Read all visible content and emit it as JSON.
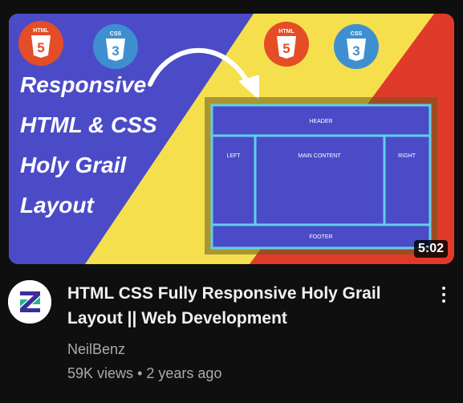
{
  "video": {
    "thumbnail": {
      "headline_lines": [
        "Responsive",
        "HTML & CSS",
        "Holy Grail",
        "Layout"
      ],
      "badges": [
        "HTML",
        "CSS",
        "HTML",
        "CSS"
      ],
      "layout_labels": {
        "header": "HEADER",
        "left": "LEFT",
        "main": "MAIN CONTENT",
        "right": "RIGHT",
        "footer": "FOOTER"
      },
      "colors": {
        "blue": "#4b4bc8",
        "yellow": "#f5df4d",
        "red": "#e03a2a",
        "html_badge": "#e44d26",
        "css_badge": "#3f8fd0"
      }
    },
    "duration": "5:02",
    "title": "HTML CSS Fully Responsive Holy Grail Layout || Web Development",
    "channel": "NeilBenz",
    "views": "59K views",
    "separator": "•",
    "age": "2 years ago",
    "menu_icon": "more-vertical-icon",
    "avatar_icon": "channel-logo-z"
  }
}
